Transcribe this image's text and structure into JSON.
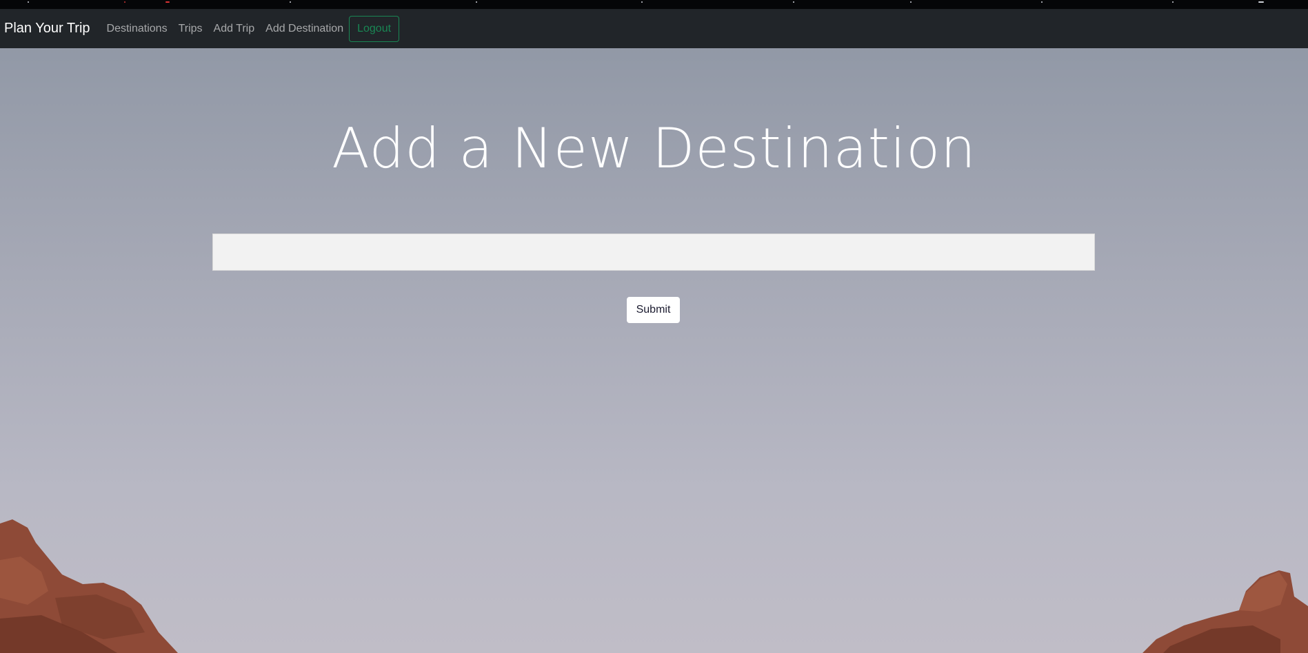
{
  "navbar": {
    "brand": "Plan Your Trip",
    "links": [
      "Destinations",
      "Trips",
      "Add Trip",
      "Add Destination"
    ],
    "logout_label": "Logout"
  },
  "form": {
    "title": "Add a New Destination",
    "input_value": "",
    "input_placeholder": "",
    "submit_label": "Submit"
  },
  "colors": {
    "navbar_bg": "#212529",
    "logout_accent": "#198754",
    "title_text": "#ffffff",
    "rock": "#8e4a37"
  }
}
